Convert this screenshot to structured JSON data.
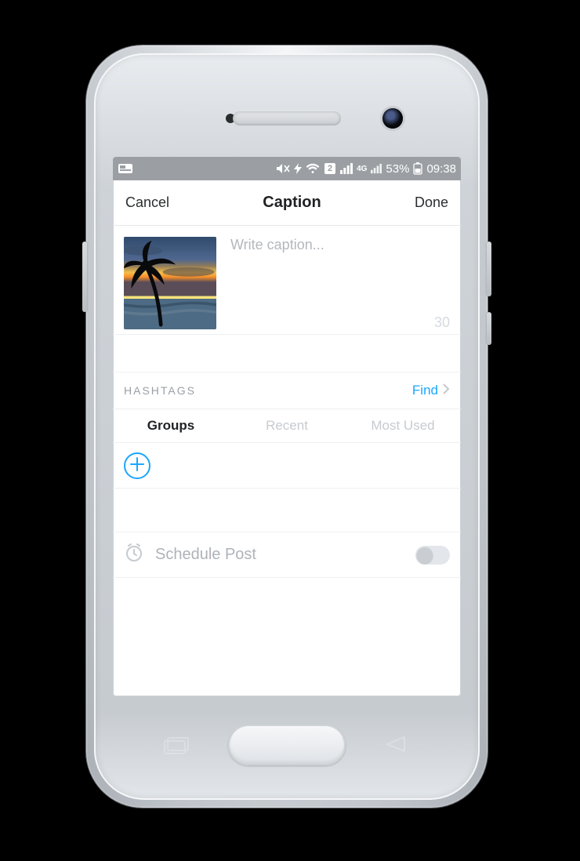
{
  "status": {
    "battery_pct": "53%",
    "time": "09:38",
    "sim_label": "2",
    "net_label": "4G"
  },
  "nav": {
    "cancel": "Cancel",
    "title": "Caption",
    "done": "Done"
  },
  "caption": {
    "placeholder": "Write caption...",
    "value": "",
    "char_count": "30"
  },
  "hashtags": {
    "section_title": "HASHTAGS",
    "find_label": "Find",
    "tabs": [
      {
        "label": "Groups",
        "active": true
      },
      {
        "label": "Recent",
        "active": false
      },
      {
        "label": "Most Used",
        "active": false
      }
    ]
  },
  "schedule": {
    "label": "Schedule Post",
    "on": false
  },
  "colors": {
    "accent": "#1aa7ff"
  }
}
